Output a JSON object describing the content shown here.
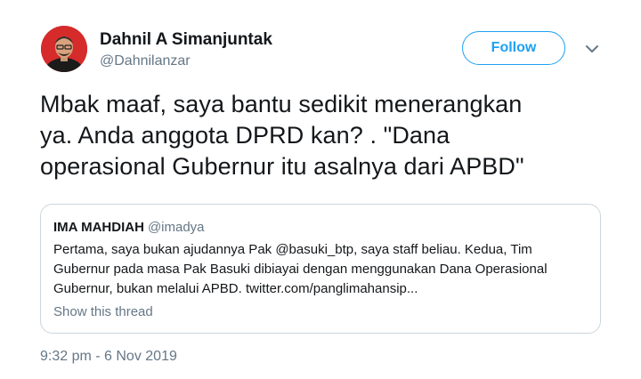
{
  "author": {
    "display_name": "Dahnil A Simanjuntak",
    "handle": "@Dahnilanzar",
    "avatar": "profile-photo"
  },
  "actions": {
    "follow_label": "Follow",
    "menu_icon": "chevron-down-icon"
  },
  "tweet": {
    "lines": [
      "Mbak maaf, saya bantu sedikit menerangkan",
      "ya. Anda anggota DPRD kan? . \"Dana",
      "operasional Gubernur itu asalnya dari APBD\""
    ],
    "timestamp": "9:32 pm - 6 Nov 2019"
  },
  "quoted_tweet": {
    "author_name": "IMA MAHDIAH",
    "author_handle": "@imadya",
    "lines": [
      "Pertama, saya bukan ajudannya Pak @basuki_btp, saya staff beliau. Kedua, Tim",
      "Gubernur pada masa Pak Basuki dibiayai dengan menggunakan Dana Operasional",
      "Gubernur, bukan melalui APBD. twitter.com/panglimahansip..."
    ],
    "show_thread_label": "Show this thread"
  },
  "colors": {
    "accent": "#1da1f2",
    "muted": "#657786",
    "border": "#ccd6dd",
    "avatar_bg": "#d62b2b"
  }
}
